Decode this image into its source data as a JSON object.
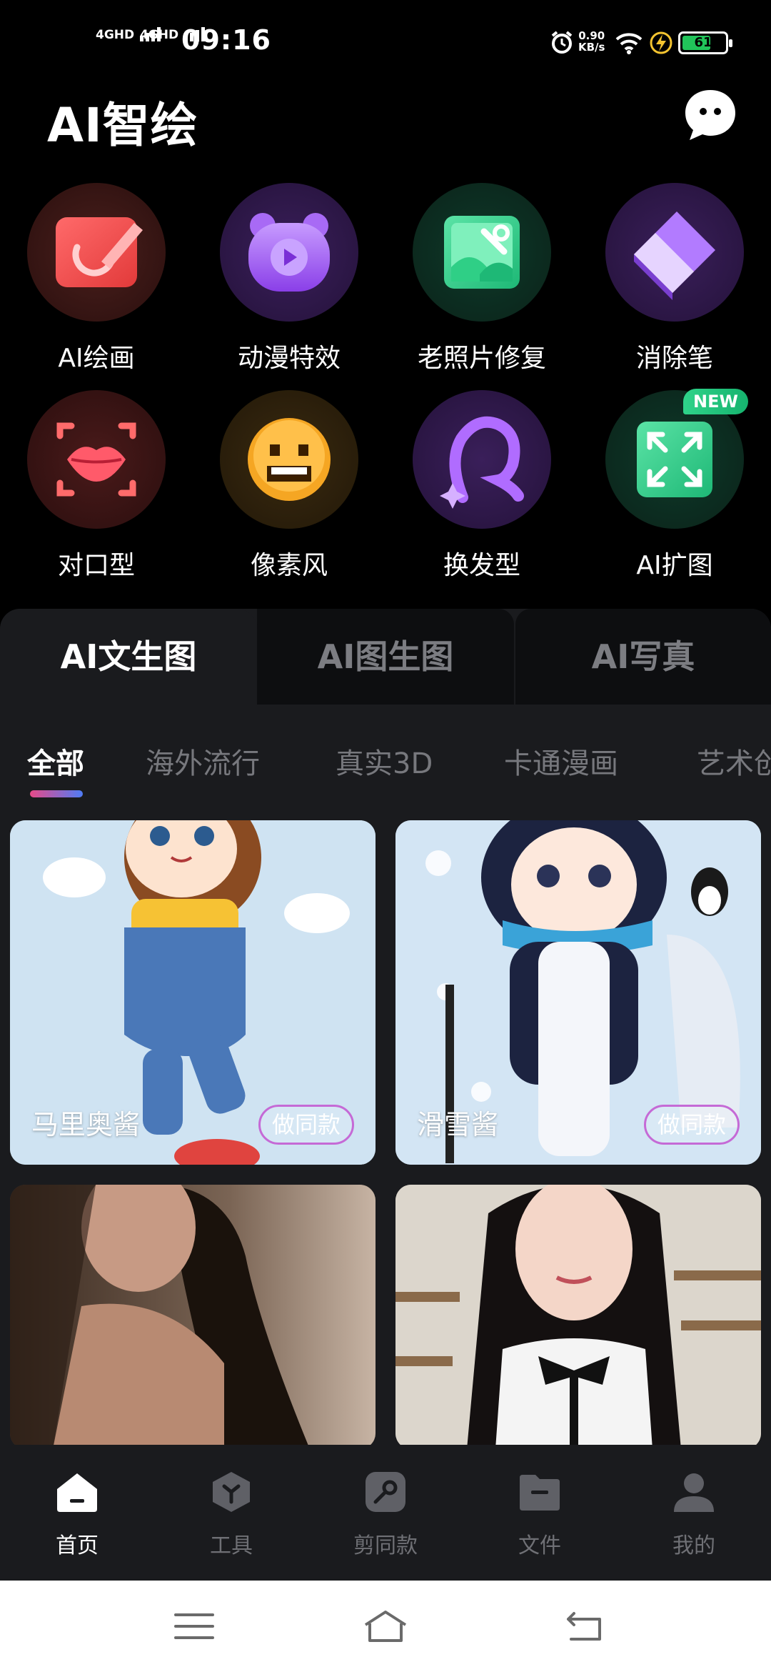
{
  "status_bar": {
    "net1": "4GHD",
    "net2": "4GHD",
    "time": "09:16",
    "speed_value": "0.90",
    "speed_unit": "KB/s",
    "battery": "61"
  },
  "header": {
    "title": "AI智绘"
  },
  "tools": [
    {
      "label": "AI绘画",
      "icon": "paint-board-icon"
    },
    {
      "label": "动漫特效",
      "icon": "anime-play-icon"
    },
    {
      "label": "老照片修复",
      "icon": "photo-repair-icon"
    },
    {
      "label": "消除笔",
      "icon": "eraser-icon"
    },
    {
      "label": "对口型",
      "icon": "lips-icon"
    },
    {
      "label": "像素风",
      "icon": "pixel-face-icon"
    },
    {
      "label": "换发型",
      "icon": "hair-icon"
    },
    {
      "label": "AI扩图",
      "icon": "expand-icon",
      "badge": "NEW"
    }
  ],
  "main_tabs": [
    {
      "label": "AI文生图",
      "active": true
    },
    {
      "label": "AI图生图",
      "active": false
    },
    {
      "label": "AI写真",
      "active": false
    }
  ],
  "sub_tabs": [
    {
      "label": "全部",
      "active": true
    },
    {
      "label": "海外流行"
    },
    {
      "label": "真实3D"
    },
    {
      "label": "卡通漫画"
    },
    {
      "label": "艺术创"
    }
  ],
  "cards": [
    {
      "caption": "马里奥酱",
      "action": "做同款"
    },
    {
      "caption": "滑雪酱",
      "action": "做同款"
    },
    {
      "caption": "",
      "action": ""
    },
    {
      "caption": "",
      "action": ""
    }
  ],
  "bottom_nav": [
    {
      "label": "首页",
      "active": true
    },
    {
      "label": "工具"
    },
    {
      "label": "剪同款"
    },
    {
      "label": "文件"
    },
    {
      "label": "我的"
    }
  ],
  "colors": {
    "accent_gradient_start": "#e74a88",
    "accent_gradient_end": "#4f7cf5",
    "new_badge": "#1fc47c",
    "battery_fill": "#21c45a"
  }
}
